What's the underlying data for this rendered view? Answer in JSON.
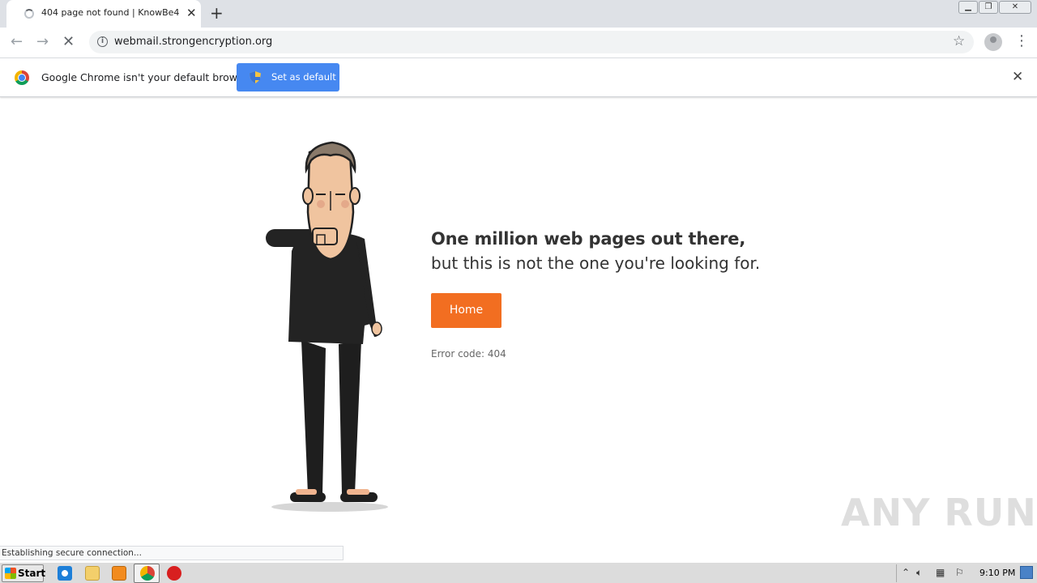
{
  "browser": {
    "tab_title": "404 page not found | KnowBe4",
    "new_tab_symbol": "+",
    "tab_close_symbol": "✕",
    "url": "webmail.strongencryption.org"
  },
  "infobar": {
    "message": "Google Chrome isn't your default browser",
    "button_label": "Set as default"
  },
  "page": {
    "headline_line1": "One million web pages out there,",
    "headline_line2": "but this is not the one you're looking for.",
    "home_button": "Home",
    "error_code": "Error code: 404"
  },
  "status_bar": {
    "text": "Establishing secure connection..."
  },
  "taskbar": {
    "start_label": "Start",
    "clock": "9:10 PM"
  },
  "watermark": "ANY RUN",
  "colors": {
    "accent_orange": "#f26e21",
    "chrome_blue": "#4688f1"
  },
  "icons": [
    "info-icon",
    "star-icon",
    "profile-icon",
    "menu-icon",
    "chrome-icon",
    "shield-icon",
    "close-icon",
    "ie-icon",
    "explorer-icon",
    "media-player-icon",
    "chrome-taskbar-icon",
    "opera-icon"
  ]
}
